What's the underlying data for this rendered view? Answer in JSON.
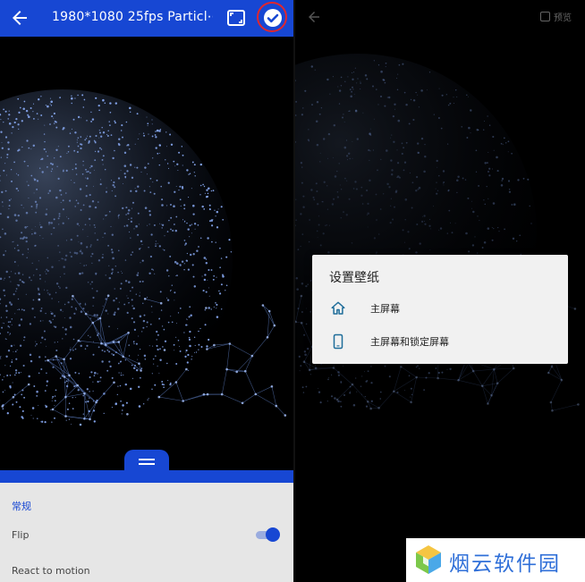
{
  "left": {
    "title": "1980*1080 25fps Particl⋯",
    "section_label": "常规",
    "flip_label": "Flip",
    "react_label": "React to motion",
    "flip_enabled": true,
    "accent": "#1747d3"
  },
  "right": {
    "preview_label": "预览",
    "dialog": {
      "title": "设置壁纸",
      "options": [
        {
          "label": "主屏幕",
          "icon": "home-icon"
        },
        {
          "label": "主屏幕和锁定屏幕",
          "icon": "phone-icon"
        }
      ]
    }
  },
  "watermark": {
    "text": "烟云软件园"
  }
}
